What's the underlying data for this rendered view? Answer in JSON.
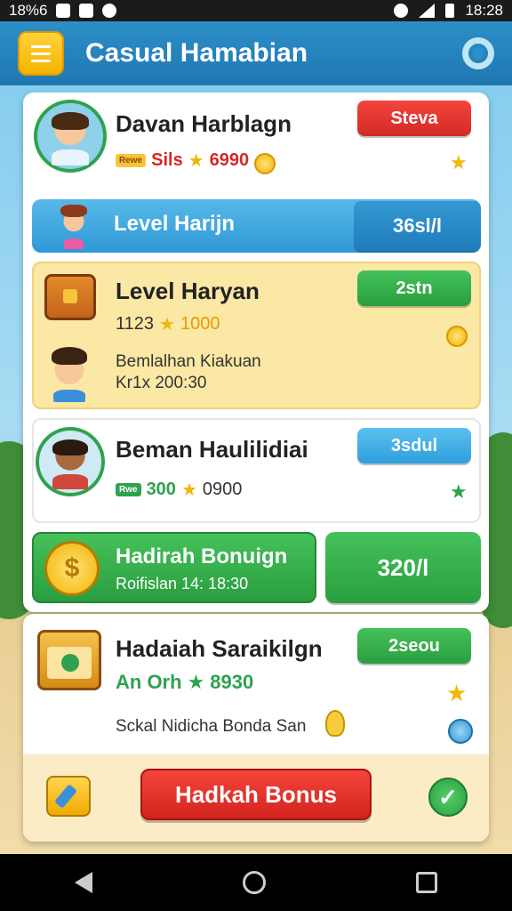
{
  "status_bar": {
    "left_text": "18%6",
    "time": "18:28"
  },
  "header": {
    "title": "Casual Hamabian",
    "menu_icon": "hamburger-menu-icon",
    "settings_icon": "gear-icon"
  },
  "player_card": {
    "name": "Davan Harblagn",
    "action_label": "Steva",
    "tag": "Rewe",
    "stat_prefix": "Sils",
    "stat_value": "6990"
  },
  "level_bar": {
    "label": "Level Harijn",
    "action_label": "36sl/l"
  },
  "level_card": {
    "name": "Level Haryan",
    "action_label": "2stn",
    "stat_prefix": "1123",
    "stat_value": "1000",
    "desc_line1": "Bemlalhan Kiakuan",
    "desc_line2": "Kr1x 200:30"
  },
  "friend_card": {
    "name": "Beman Haulilidiai",
    "action_label": "3sdul",
    "tag": "Rwe",
    "stat_prefix": "300",
    "stat_value": "0900"
  },
  "bonus_bar": {
    "title": "Hadirah Bonuign",
    "subtitle": "Roifislan 14: 18:30",
    "action_label": "320/l"
  },
  "reward_card": {
    "name": "Hadaiah Saraikilgn",
    "action_label": "2seou",
    "stat_prefix": "An Orh",
    "stat_value": "8930",
    "desc": "Sckal Nidicha Bonda San"
  },
  "cta": {
    "label": "Hadkah Bonus"
  },
  "colors": {
    "header": "#2d8fc9",
    "red": "#e3342c",
    "green": "#2fa24e",
    "blue": "#2f98d7",
    "yellow_card": "#fbe8a4"
  }
}
